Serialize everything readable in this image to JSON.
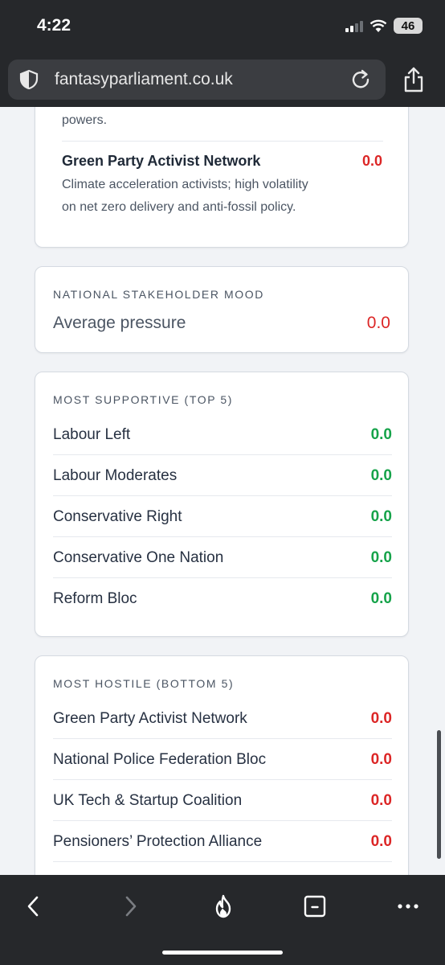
{
  "status": {
    "time": "4:22",
    "battery": "46"
  },
  "browser": {
    "url": "fantasyparliament.co.uk"
  },
  "top_card": {
    "tail_text": "powers.",
    "item_name": "Green Party Activist Network",
    "item_value": "0.0",
    "item_desc_line1": "Climate acceleration activists; high volatility",
    "item_desc_line2": "on net zero delivery and anti-fossil policy."
  },
  "mood": {
    "label": "NATIONAL STAKEHOLDER MOOD",
    "name": "Average pressure",
    "value": "0.0"
  },
  "supportive": {
    "label": "MOST SUPPORTIVE (TOP 5)",
    "rows": [
      {
        "name": "Labour Left",
        "value": "0.0"
      },
      {
        "name": "Labour Moderates",
        "value": "0.0"
      },
      {
        "name": "Conservative Right",
        "value": "0.0"
      },
      {
        "name": "Conservative One Nation",
        "value": "0.0"
      },
      {
        "name": "Reform Bloc",
        "value": "0.0"
      }
    ]
  },
  "hostile": {
    "label": "MOST HOSTILE (BOTTOM 5)",
    "rows": [
      {
        "name": "Green Party Activist Network",
        "value": "0.0"
      },
      {
        "name": "National Police Federation Bloc",
        "value": "0.0"
      },
      {
        "name": "UK Tech & Startup Coalition",
        "value": "0.0"
      },
      {
        "name": "Pensioners’ Protection Alliance",
        "value": "0.0"
      }
    ]
  },
  "colors": {
    "positive": "#16a34a",
    "negative": "#dc2626",
    "chrome": "#26282b"
  },
  "icons": [
    "shield-icon",
    "reload-icon",
    "share-icon",
    "back-icon",
    "forward-icon",
    "flame-icon",
    "tabs-icon",
    "more-icon"
  ]
}
